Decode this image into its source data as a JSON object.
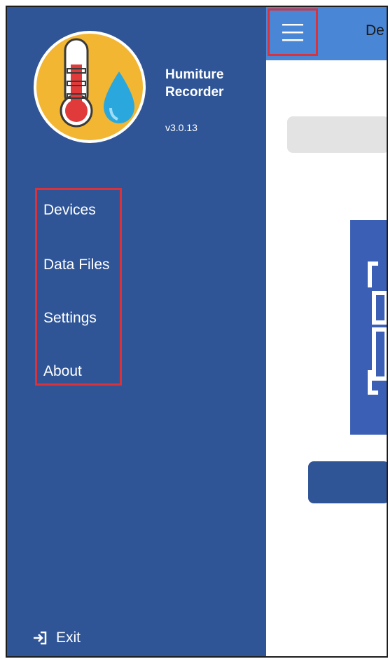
{
  "app": {
    "name": "Humiture Recorder",
    "version": "v3.0.13"
  },
  "drawer": {
    "menu_items": [
      {
        "label": "Devices"
      },
      {
        "label": "Data Files"
      },
      {
        "label": "Settings"
      },
      {
        "label": "About"
      }
    ],
    "exit_label": "Exit"
  },
  "appbar": {
    "title_partial": "De"
  },
  "colors": {
    "drawer_bg": "#2f5597",
    "appbar_bg": "#4a86d6",
    "highlight_box": "#d9323a",
    "logo_circle": "#f2b632",
    "thermometer_red": "#e03a3a",
    "droplet_blue": "#2aa8dd"
  },
  "icons": [
    "thermometer-icon",
    "water-drop-icon",
    "hamburger-menu-icon",
    "exit-icon",
    "scan-frame-icon"
  ]
}
